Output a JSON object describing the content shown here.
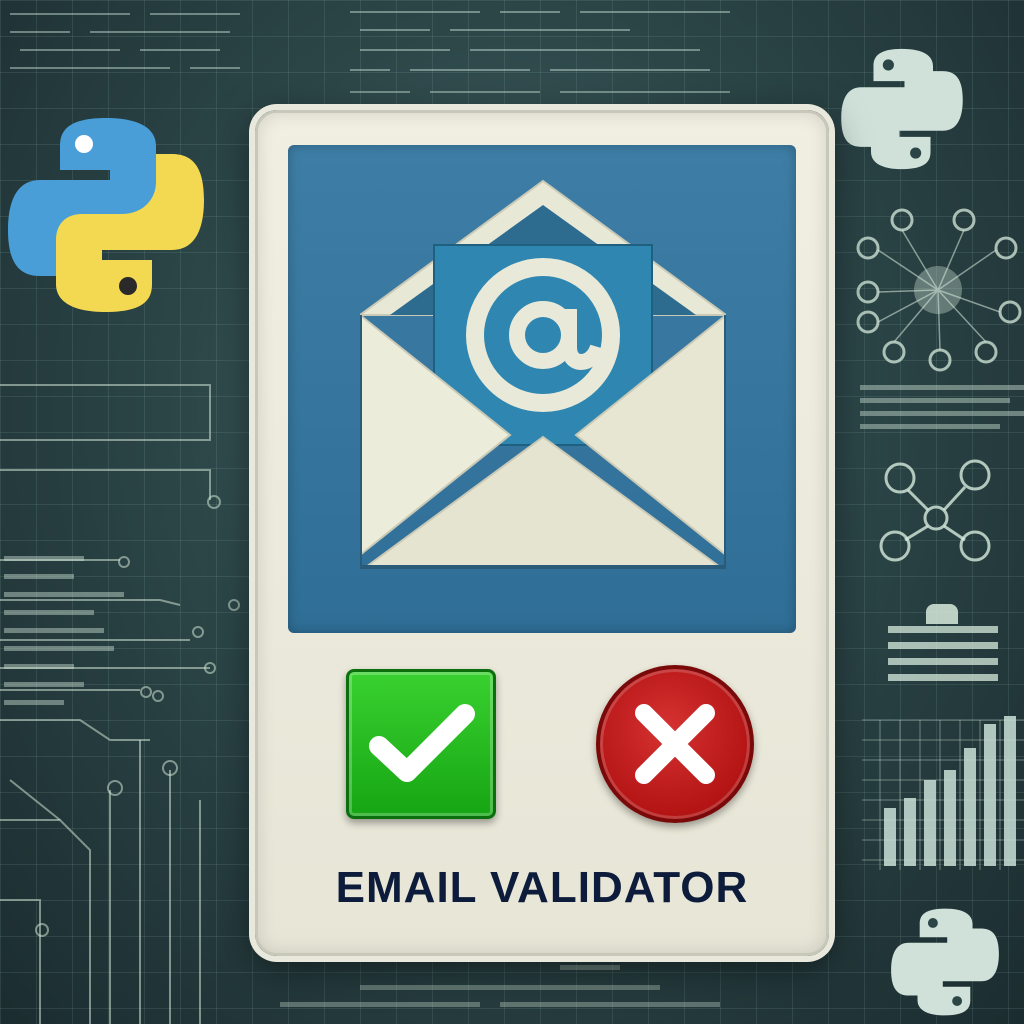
{
  "title": "EMAIL VALIDATOR",
  "icons": {
    "logo_main": "python-logo-icon",
    "envelope": "envelope-icon",
    "at_symbol": "at-sign-icon",
    "valid": "checkmark-icon",
    "invalid": "x-icon"
  },
  "colors": {
    "panel_blue": "#2f6e96",
    "valid_green": "#1db51a",
    "invalid_red": "#c21d1d",
    "python_blue": "#4a9ed8",
    "python_yellow": "#f3d851",
    "title_text": "#0d1c3a"
  }
}
